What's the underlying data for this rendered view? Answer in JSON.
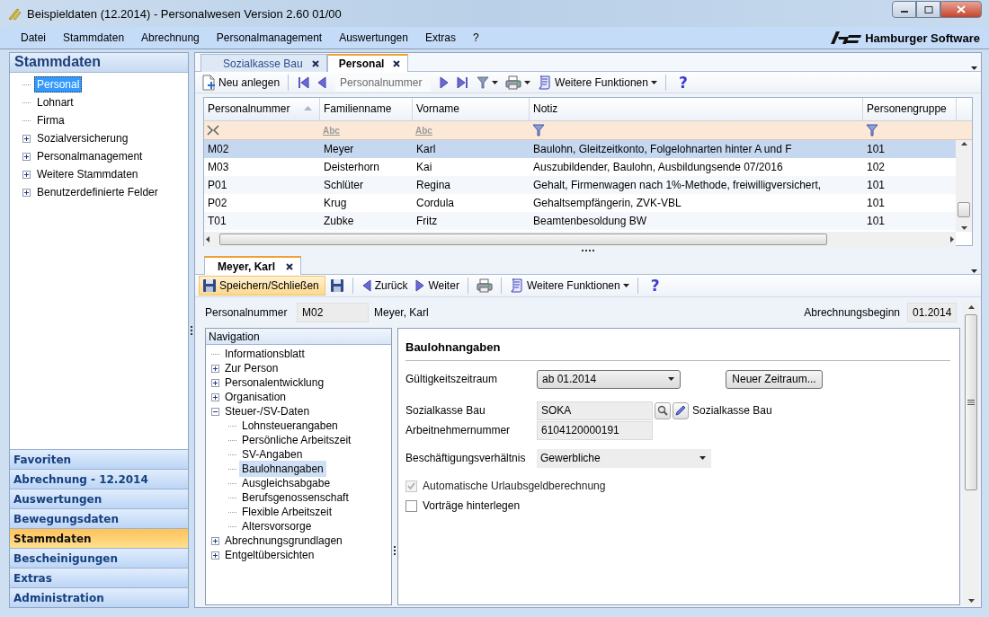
{
  "window": {
    "title": "Beispieldaten (12.2014) - Personalwesen Version 2.60 01/00"
  },
  "menu": [
    "Datei",
    "Stammdaten",
    "Abrechnung",
    "Personalmanagement",
    "Auswertungen",
    "Extras",
    "?"
  ],
  "brand": "Hamburger Software",
  "sidebar": {
    "title": "Stammdaten",
    "tree": [
      {
        "label": "Personal",
        "kind": "leaf",
        "selected": true
      },
      {
        "label": "Lohnart",
        "kind": "leaf",
        "selected": false
      },
      {
        "label": "Firma",
        "kind": "leaf",
        "selected": false
      },
      {
        "label": "Sozialversicherung",
        "kind": "folder",
        "expanded": false,
        "selected": false
      },
      {
        "label": "Personalmanagement",
        "kind": "folder",
        "expanded": false,
        "selected": false
      },
      {
        "label": "Weitere Stammdaten",
        "kind": "folder",
        "expanded": false,
        "selected": false
      },
      {
        "label": "Benutzerdefinierte Felder",
        "kind": "folder",
        "expanded": false,
        "selected": false
      }
    ],
    "nav": [
      {
        "label": "Favoriten",
        "selected": false
      },
      {
        "label": "Abrechnung - 12.2014",
        "selected": false
      },
      {
        "label": "Auswertungen",
        "selected": false
      },
      {
        "label": "Bewegungsdaten",
        "selected": false
      },
      {
        "label": "Stammdaten",
        "selected": true
      },
      {
        "label": "Bescheinigungen",
        "selected": false
      },
      {
        "label": "Extras",
        "selected": false
      },
      {
        "label": "Administration",
        "selected": false
      }
    ]
  },
  "doc_tabs": [
    {
      "label": "Sozialkasse Bau",
      "selected": false
    },
    {
      "label": "Personal",
      "selected": true
    }
  ],
  "toolbar": [
    {
      "kind": "new",
      "label": "Neu anlegen"
    },
    {
      "kind": "separator"
    },
    {
      "kind": "first"
    },
    {
      "kind": "prev"
    },
    {
      "kind": "search",
      "placeholder": "Personalnummer"
    },
    {
      "kind": "next"
    },
    {
      "kind": "last"
    },
    {
      "kind": "filter"
    },
    {
      "kind": "print"
    },
    {
      "kind": "more",
      "label": "Weitere Funktionen"
    },
    {
      "kind": "separator"
    },
    {
      "kind": "help",
      "label": "?"
    }
  ],
  "grid": {
    "columns": [
      {
        "label": "Personalnummer",
        "sorted": true
      },
      {
        "label": "Familienname",
        "sorted": false
      },
      {
        "label": "Vorname",
        "sorted": false
      },
      {
        "label": "Notiz",
        "sorted": false
      },
      {
        "label": "Personengruppe",
        "sorted": false
      }
    ],
    "filter_row": [
      {
        "kind": "clear"
      },
      {
        "kind": "text",
        "label": "Abc"
      },
      {
        "kind": "text",
        "label": "Abc"
      },
      {
        "kind": "funnel"
      },
      {
        "kind": "funnel"
      }
    ],
    "rows": [
      {
        "selected": true,
        "cells": [
          "M02",
          "Meyer",
          "Karl",
          "Baulohn, Gleitzeitkonto, Folgelohnarten hinter A und F",
          "101"
        ]
      },
      {
        "selected": false,
        "cells": [
          "M03",
          "Deisterhorn",
          "Kai",
          "Auszubildender, Baulohn, Ausbildungsende 07/2016",
          "102"
        ]
      },
      {
        "selected": false,
        "cells": [
          "P01",
          "Schlüter",
          "Regina",
          "Gehalt, Firmenwagen nach 1%-Methode, freiwilligversichert,",
          "101"
        ]
      },
      {
        "selected": false,
        "cells": [
          "P02",
          "Krug",
          "Cordula",
          "Gehaltsempfängerin, ZVK-VBL",
          "101"
        ]
      },
      {
        "selected": false,
        "cells": [
          "T01",
          "Zubke",
          "Fritz",
          "Beamtenbesoldung BW",
          "101"
        ]
      }
    ]
  },
  "detail": {
    "tab": "Meyer, Karl",
    "toolbar": [
      {
        "kind": "save_close",
        "label": "Speichern/Schließen"
      },
      {
        "kind": "save"
      },
      {
        "kind": "separator"
      },
      {
        "kind": "prev",
        "label": "Zurück"
      },
      {
        "kind": "next",
        "label": "Weiter"
      },
      {
        "kind": "separator"
      },
      {
        "kind": "print"
      },
      {
        "kind": "separator"
      },
      {
        "kind": "more",
        "label": "Weitere Funktionen"
      },
      {
        "kind": "separator"
      },
      {
        "kind": "help",
        "label": "?"
      }
    ],
    "header": {
      "number_label": "Personalnummer",
      "number": "M02",
      "name": "Meyer, Karl",
      "start_label": "Abrechnungsbeginn",
      "start": "01.2014"
    },
    "navigation": {
      "title": "Navigation",
      "items": [
        {
          "label": "Informationsblatt",
          "kind": "leaf",
          "selected": false
        },
        {
          "label": "Zur Person",
          "kind": "folder",
          "expanded": false,
          "selected": false
        },
        {
          "label": "Personalentwicklung",
          "kind": "folder",
          "expanded": false,
          "selected": false
        },
        {
          "label": "Organisation",
          "kind": "folder",
          "expanded": false,
          "selected": false
        },
        {
          "label": "Steuer-/SV-Daten",
          "kind": "folder",
          "expanded": true,
          "selected": false,
          "children": [
            {
              "label": "Lohnsteuerangaben",
              "kind": "leaf",
              "selected": false
            },
            {
              "label": "Persönliche Arbeitszeit",
              "kind": "leaf",
              "selected": false
            },
            {
              "label": "SV-Angaben",
              "kind": "leaf",
              "selected": false
            },
            {
              "label": "Baulohnangaben",
              "kind": "leaf",
              "selected": true
            },
            {
              "label": "Ausgleichsabgabe",
              "kind": "leaf",
              "selected": false
            },
            {
              "label": "Berufsgenossenschaft",
              "kind": "leaf",
              "selected": false
            },
            {
              "label": "Flexible Arbeitszeit",
              "kind": "leaf",
              "selected": false
            },
            {
              "label": "Altersvorsorge",
              "kind": "leaf",
              "selected": false
            }
          ]
        },
        {
          "label": "Abrechnungsgrundlagen",
          "kind": "folder",
          "expanded": false,
          "selected": false
        },
        {
          "label": "Entgeltübersichten",
          "kind": "folder",
          "expanded": false,
          "selected": false
        }
      ]
    },
    "form": {
      "title": "Baulohnangaben",
      "fields": [
        {
          "kind": "dropdown",
          "label": "Gültigkeitszeitraum",
          "value": "ab 01.2014",
          "button": "Neuer Zeitraum..."
        },
        {
          "kind": "lookup",
          "label": "Sozialkasse Bau",
          "value": "SOKA",
          "description": "Sozialkasse Bau"
        },
        {
          "kind": "text",
          "label": "Arbeitnehmernummer",
          "value": "6104120000191"
        },
        {
          "kind": "combo",
          "label": "Beschäftigungsverhältnis",
          "value": "Gewerbliche"
        },
        {
          "kind": "checkbox",
          "label": "Automatische Urlaubsgeldberechnung",
          "checked": true,
          "disabled": true
        },
        {
          "kind": "checkbox",
          "label": "Vorträge hinterlegen",
          "checked": false,
          "disabled": false
        }
      ]
    }
  }
}
